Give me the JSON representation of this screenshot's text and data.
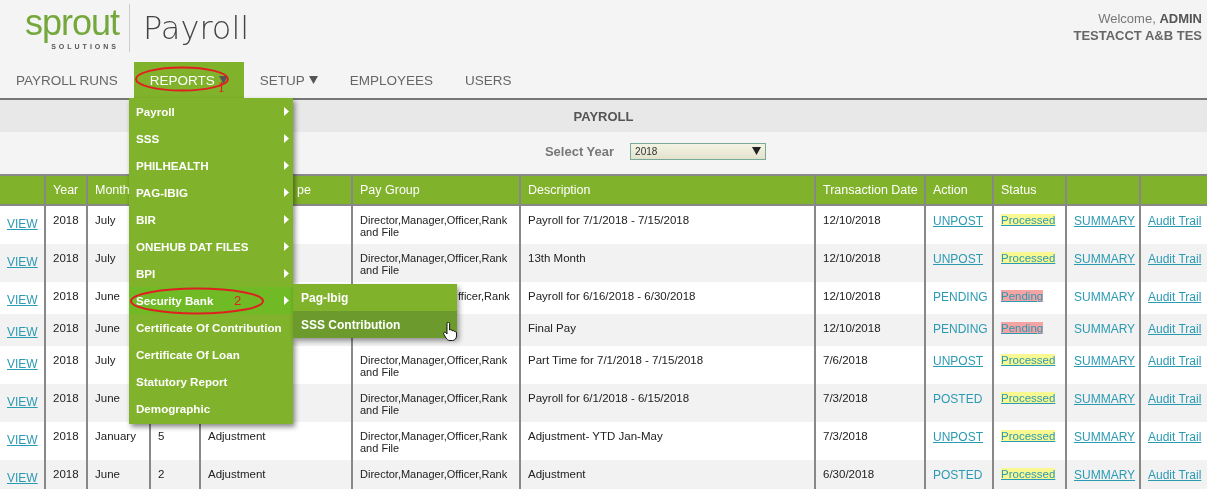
{
  "logo": {
    "word": "sprout",
    "tagline": "SOLUTIONS"
  },
  "app_title": "Payroll",
  "user": {
    "welcome": "Welcome, **ADMIN**",
    "company": "TESTACCT A&B TES"
  },
  "nav": [
    {
      "label": "PAYROLL RUNS",
      "selected": false,
      "dropdown": false
    },
    {
      "label": "REPORTS",
      "selected": true,
      "dropdown": true,
      "annotation": "1"
    },
    {
      "label": "SETUP",
      "selected": false,
      "dropdown": true
    },
    {
      "label": "EMPLOYEES",
      "selected": false,
      "dropdown": false
    },
    {
      "label": "USERS",
      "selected": false,
      "dropdown": false
    }
  ],
  "section_title": "PAYROLL",
  "year_filter": {
    "label": "Select Year",
    "value": "2018"
  },
  "reports_menu": [
    {
      "label": "Payroll",
      "submenu": true,
      "selected": false
    },
    {
      "label": "SSS",
      "submenu": true,
      "selected": false
    },
    {
      "label": "PHILHEALTH",
      "submenu": true,
      "selected": false
    },
    {
      "label": "PAG-IBIG",
      "submenu": true,
      "selected": false
    },
    {
      "label": "BIR",
      "submenu": true,
      "selected": false
    },
    {
      "label": "ONEHUB DAT FILES",
      "submenu": true,
      "selected": false
    },
    {
      "label": "BPI",
      "submenu": true,
      "selected": false
    },
    {
      "label": "Security Bank",
      "submenu": true,
      "selected": true,
      "annotation": "2",
      "children": [
        {
          "label": "Pag-Ibig",
          "selected": false
        },
        {
          "label": "SSS Contribution",
          "selected": true
        }
      ]
    },
    {
      "label": "Certificate Of Contribution",
      "submenu": false,
      "selected": false
    },
    {
      "label": "Certificate Of Loan",
      "submenu": false,
      "selected": false
    },
    {
      "label": "Statutory Report",
      "submenu": false,
      "selected": false
    },
    {
      "label": "Demographic",
      "submenu": false,
      "selected": false
    }
  ],
  "table": {
    "columns": [
      "",
      "Year",
      "Month",
      "",
      "pe",
      "Pay Group",
      "Description",
      "Transaction Date",
      "Action",
      "Status",
      "",
      ""
    ],
    "rows": [
      {
        "view": "VIEW",
        "year": "2018",
        "month": "July",
        "pay_group": [
          "Director,Manager,Officer,Rank",
          "and File"
        ],
        "description": "Payroll for 7/1/2018 - 7/15/2018",
        "date": "12/10/2018",
        "action": {
          "text": "UNPOST",
          "link": true
        },
        "status": {
          "text": "Processed",
          "color": "#faf890"
        },
        "summary": {
          "text": "SUMMARY",
          "link": true
        },
        "audit": "Audit Trail"
      },
      {
        "view": "VIEW",
        "year": "2018",
        "month": "July",
        "pay_group": [
          "Director,Manager,Officer,Rank",
          "and File"
        ],
        "description": "13th Month",
        "date": "12/10/2018",
        "action": {
          "text": "UNPOST",
          "link": true
        },
        "status": {
          "text": "Processed",
          "color": "#faf890"
        },
        "summary": {
          "text": "SUMMARY",
          "link": true
        },
        "audit": "Audit Trail"
      },
      {
        "view": "VIEW",
        "year": "2018",
        "month": "June",
        "pay_group_partial": "fficer,Rank",
        "description": "Payroll for 6/16/2018 - 6/30/2018",
        "date": "12/10/2018",
        "action": {
          "text": "PENDING",
          "link": false
        },
        "status": {
          "text": "Pending",
          "color": "#f5a3a3"
        },
        "summary": {
          "text": "SUMMARY",
          "link": false
        },
        "audit": "Audit Trail"
      },
      {
        "view": "VIEW",
        "year": "2018",
        "month": "June",
        "description": "Final Pay",
        "date": "12/10/2018",
        "action": {
          "text": "PENDING",
          "link": false
        },
        "status": {
          "text": "Pending",
          "color": "#f5a3a3"
        },
        "summary": {
          "text": "SUMMARY",
          "link": false
        },
        "audit": "Audit Trail"
      },
      {
        "view": "VIEW",
        "year": "2018",
        "month": "July",
        "pay_group": [
          "Director,Manager,Officer,Rank",
          "and File"
        ],
        "description": "Part Time for 7/1/2018 - 7/15/2018",
        "date": "7/6/2018",
        "action": {
          "text": "UNPOST",
          "link": true
        },
        "status": {
          "text": "Processed",
          "color": "#faf890"
        },
        "summary": {
          "text": "SUMMARY",
          "link": true
        },
        "audit": "Audit Trail"
      },
      {
        "view": "VIEW",
        "year": "2018",
        "month": "June",
        "pay_group": [
          "Director,Manager,Officer,Rank",
          "and File"
        ],
        "description": "Payroll for 6/1/2018 - 6/15/2018",
        "date": "7/3/2018",
        "action": {
          "text": "POSTED",
          "link": false
        },
        "status": {
          "text": "Processed",
          "color": "#faf890"
        },
        "summary": {
          "text": "SUMMARY",
          "link": true
        },
        "audit": "Audit Trail"
      },
      {
        "view": "VIEW",
        "year": "2018",
        "month": "January",
        "number": "5",
        "type": "Adjustment",
        "pay_group": [
          "Director,Manager,Officer,Rank",
          "and File"
        ],
        "description": "Adjustment- YTD Jan-May",
        "date": "7/3/2018",
        "action": {
          "text": "UNPOST",
          "link": true
        },
        "status": {
          "text": "Processed",
          "color": "#faf890"
        },
        "summary": {
          "text": "SUMMARY",
          "link": true
        },
        "audit": "Audit Trail"
      },
      {
        "view": "VIEW",
        "year": "2018",
        "month": "June",
        "number": "2",
        "type": "Adjustment",
        "pay_group": [
          "Director,Manager,Officer,Rank"
        ],
        "description": "Adjustment",
        "date": "6/30/2018",
        "action": {
          "text": "POSTED",
          "link": false
        },
        "status": {
          "text": "Processed",
          "color": "#faf890"
        },
        "summary": {
          "text": "SUMMARY",
          "link": true
        },
        "audit": "Audit Trail"
      }
    ]
  }
}
